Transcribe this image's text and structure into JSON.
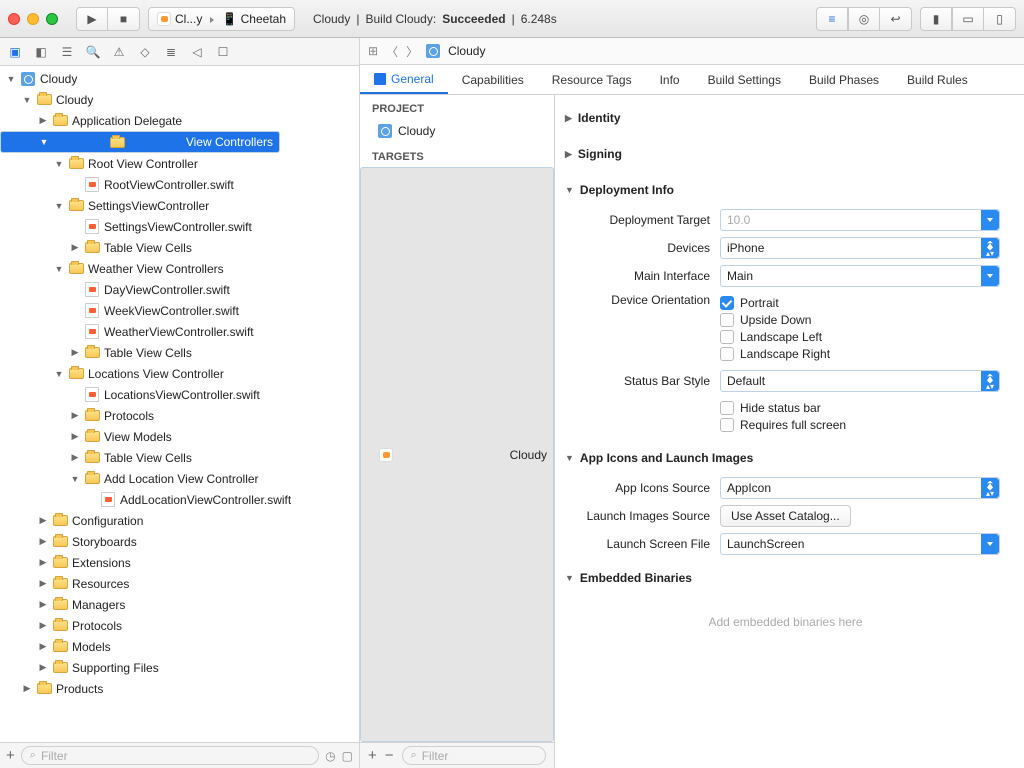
{
  "toolbar": {
    "scheme_app": "Cl...y",
    "scheme_device": "Cheetah",
    "status_project": "Cloudy",
    "status_action": "Build Cloudy:",
    "status_result": "Succeeded",
    "status_time": "6.248s"
  },
  "jumpbar": {
    "path": "Cloudy"
  },
  "navigator": {
    "filter_placeholder": "Filter",
    "tree": [
      {
        "d": 0,
        "t": "proj",
        "o": "open",
        "l": "Cloudy"
      },
      {
        "d": 1,
        "t": "folder",
        "o": "open",
        "l": "Cloudy"
      },
      {
        "d": 2,
        "t": "folder",
        "o": "closed",
        "l": "Application Delegate"
      },
      {
        "d": 2,
        "t": "folder",
        "o": "open",
        "l": "View Controllers",
        "sel": true
      },
      {
        "d": 3,
        "t": "folder",
        "o": "open",
        "l": "Root View Controller"
      },
      {
        "d": 4,
        "t": "swift",
        "o": "none",
        "l": "RootViewController.swift"
      },
      {
        "d": 3,
        "t": "folder",
        "o": "open",
        "l": "SettingsViewController"
      },
      {
        "d": 4,
        "t": "swift",
        "o": "none",
        "l": "SettingsViewController.swift"
      },
      {
        "d": 4,
        "t": "folder",
        "o": "closed",
        "l": "Table View Cells"
      },
      {
        "d": 3,
        "t": "folder",
        "o": "open",
        "l": "Weather View Controllers"
      },
      {
        "d": 4,
        "t": "swift",
        "o": "none",
        "l": "DayViewController.swift"
      },
      {
        "d": 4,
        "t": "swift",
        "o": "none",
        "l": "WeekViewController.swift"
      },
      {
        "d": 4,
        "t": "swift",
        "o": "none",
        "l": "WeatherViewController.swift"
      },
      {
        "d": 4,
        "t": "folder",
        "o": "closed",
        "l": "Table View Cells"
      },
      {
        "d": 3,
        "t": "folder",
        "o": "open",
        "l": "Locations View Controller"
      },
      {
        "d": 4,
        "t": "swift",
        "o": "none",
        "l": "LocationsViewController.swift"
      },
      {
        "d": 4,
        "t": "folder",
        "o": "closed",
        "l": "Protocols"
      },
      {
        "d": 4,
        "t": "folder",
        "o": "closed",
        "l": "View Models"
      },
      {
        "d": 4,
        "t": "folder",
        "o": "closed",
        "l": "Table View Cells"
      },
      {
        "d": 4,
        "t": "folder",
        "o": "open",
        "l": "Add Location View Controller"
      },
      {
        "d": 5,
        "t": "swift",
        "o": "none",
        "l": "AddLocationViewController.swift"
      },
      {
        "d": 2,
        "t": "folder",
        "o": "closed",
        "l": "Configuration"
      },
      {
        "d": 2,
        "t": "folder",
        "o": "closed",
        "l": "Storyboards"
      },
      {
        "d": 2,
        "t": "folder",
        "o": "closed",
        "l": "Extensions"
      },
      {
        "d": 2,
        "t": "folder",
        "o": "closed",
        "l": "Resources"
      },
      {
        "d": 2,
        "t": "folder",
        "o": "closed",
        "l": "Managers"
      },
      {
        "d": 2,
        "t": "folder",
        "o": "closed",
        "l": "Protocols"
      },
      {
        "d": 2,
        "t": "folder",
        "o": "closed",
        "l": "Models"
      },
      {
        "d": 2,
        "t": "folder",
        "o": "closed",
        "l": "Supporting Files"
      },
      {
        "d": 1,
        "t": "folder",
        "o": "closed",
        "l": "Products"
      }
    ]
  },
  "outline": {
    "project_header": "PROJECT",
    "project_name": "Cloudy",
    "targets_header": "TARGETS",
    "target_name": "Cloudy",
    "filter_placeholder": "Filter"
  },
  "tabs": [
    "General",
    "Capabilities",
    "Resource Tags",
    "Info",
    "Build Settings",
    "Build Phases",
    "Build Rules"
  ],
  "form": {
    "identity_h": "Identity",
    "signing_h": "Signing",
    "deploy_h": "Deployment Info",
    "deploy_target_l": "Deployment Target",
    "deploy_target_v": "10.0",
    "devices_l": "Devices",
    "devices_v": "iPhone",
    "main_if_l": "Main Interface",
    "main_if_v": "Main",
    "orient_l": "Device Orientation",
    "orient_portrait": "Portrait",
    "orient_upside": "Upside Down",
    "orient_land_l": "Landscape Left",
    "orient_land_r": "Landscape Right",
    "status_style_l": "Status Bar Style",
    "status_style_v": "Default",
    "hide_status": "Hide status bar",
    "req_full": "Requires full screen",
    "icons_h": "App Icons and Launch Images",
    "appicons_l": "App Icons Source",
    "appicons_v": "AppIcon",
    "launchimg_l": "Launch Images Source",
    "launchimg_btn": "Use Asset Catalog...",
    "launchscr_l": "Launch Screen File",
    "launchscr_v": "LaunchScreen",
    "embed_h": "Embedded Binaries",
    "embed_placeholder": "Add embedded binaries here"
  }
}
